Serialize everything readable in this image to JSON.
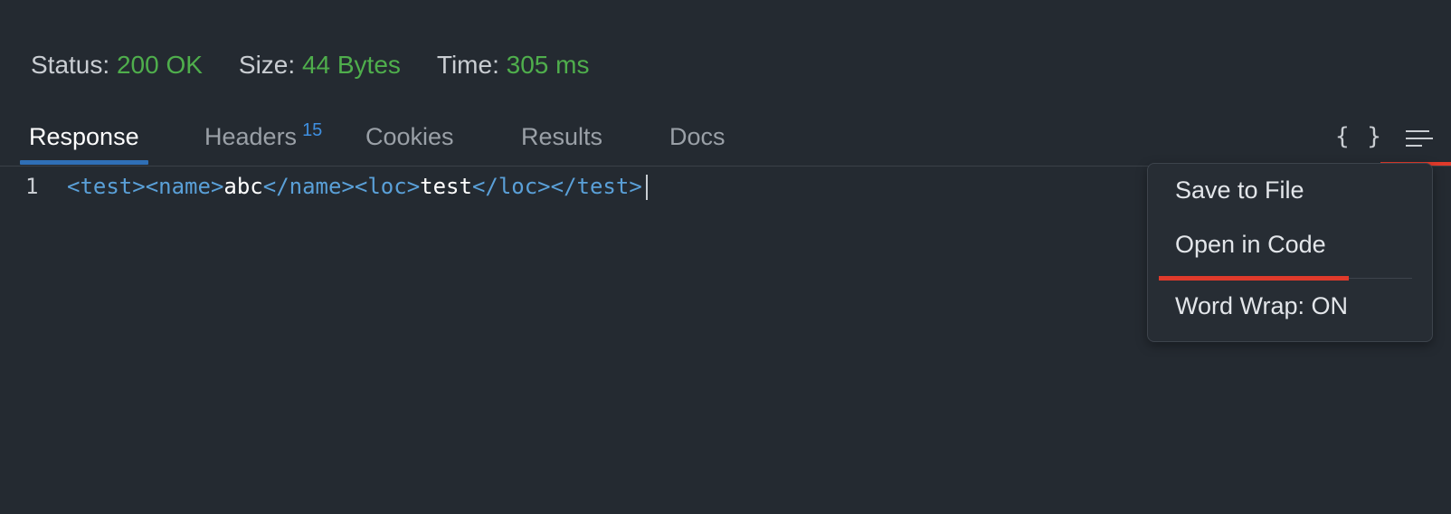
{
  "status": {
    "status_label": "Status:",
    "status_value": "200 OK",
    "size_label": "Size:",
    "size_value": "44 Bytes",
    "time_label": "Time:",
    "time_value": "305 ms",
    "value_color": "#4fae4c"
  },
  "tabs": [
    {
      "label": "Response",
      "active": true
    },
    {
      "label": "Headers",
      "badge": "15"
    },
    {
      "label": "Cookies"
    },
    {
      "label": "Results"
    },
    {
      "label": "Docs"
    }
  ],
  "toolbar": {
    "json_icon": "{ }",
    "json_icon_name": "json-format-icon",
    "menu_icon_name": "menu-icon"
  },
  "editor": {
    "line_number": "1",
    "tokens": {
      "t1": "<test><name>",
      "t2": "abc",
      "t3": "</name><loc>",
      "t4": "test",
      "t5": "</loc></test>"
    }
  },
  "menu": {
    "items": [
      "Save to File",
      "Open in Code",
      "Word Wrap: ON"
    ]
  },
  "colors": {
    "background": "#242a31",
    "accent_tab": "#2f6fb6",
    "annotation_red": "#e03a2b",
    "tag_color": "#5aa0d8",
    "badge_color": "#3f8fe0"
  }
}
